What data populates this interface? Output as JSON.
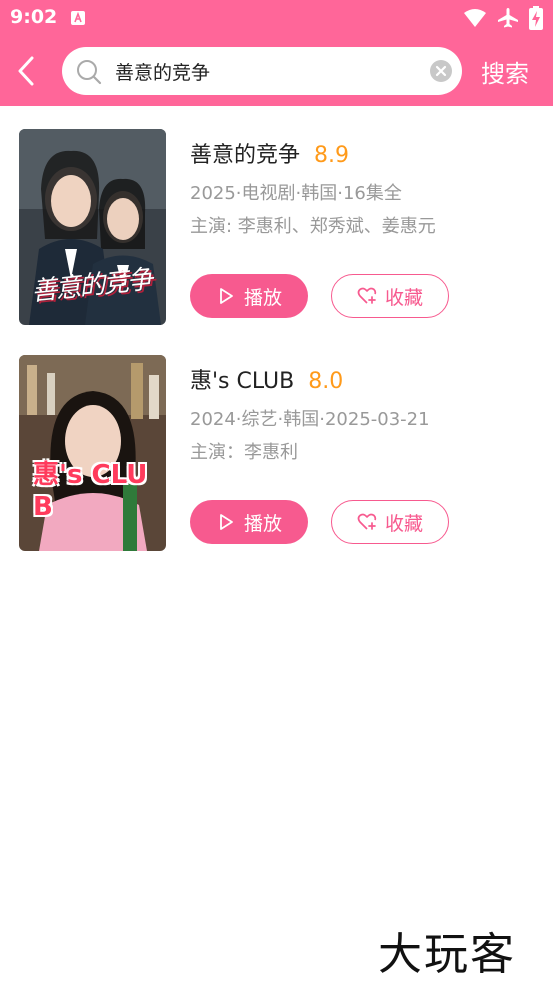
{
  "status_bar": {
    "time": "9:02",
    "icons": [
      "text-input-icon",
      "wifi-icon",
      "airplane-icon",
      "battery-charging-icon"
    ]
  },
  "header": {
    "search": {
      "value": "善意的竞争",
      "placeholder": ""
    },
    "search_button_label": "搜索"
  },
  "results": [
    {
      "title": "善意的竞争",
      "score": "8.9",
      "meta": "2025·电视剧·韩国·16集全",
      "cast": "主演: 李惠利、郑秀斌、姜惠元",
      "play_label": "播放",
      "fav_label": "收藏",
      "poster_text": "善意的竞争"
    },
    {
      "title": "惠's CLUB",
      "score": "8.0",
      "meta": "2024·综艺·韩国·2025-03-21",
      "cast": "主演：李惠利",
      "play_label": "播放",
      "fav_label": "收藏",
      "poster_text": "惠's CLUB"
    }
  ],
  "watermark": "大玩客",
  "colors": {
    "brand": "#ff6699",
    "button": "#f75a8f",
    "score": "#ff9a1a",
    "muted_text": "#999999"
  }
}
